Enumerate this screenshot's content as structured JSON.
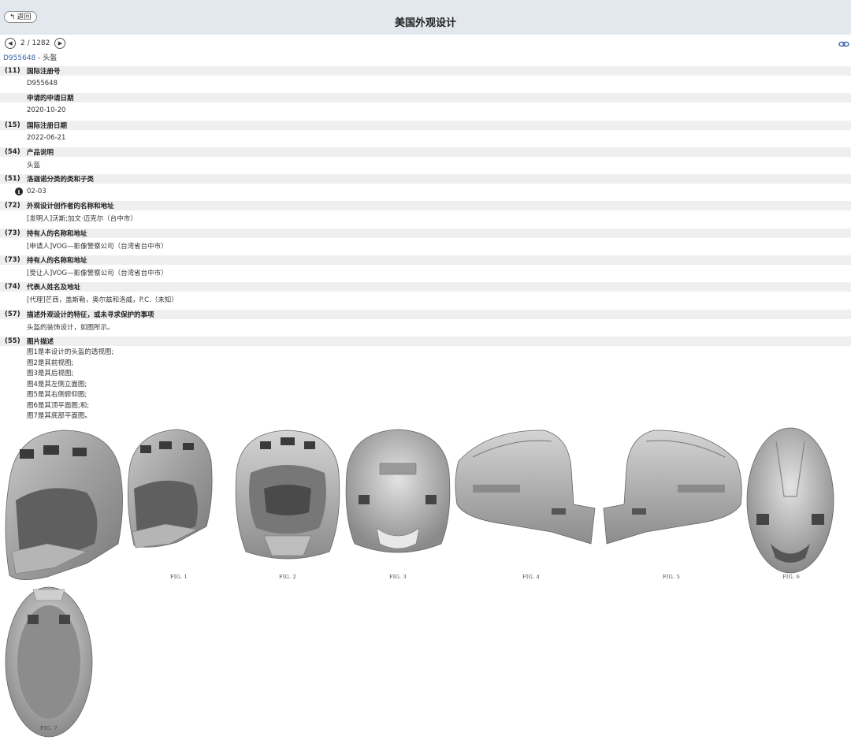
{
  "header": {
    "back_label": "返回",
    "title": "美国外观设计"
  },
  "pager": {
    "count": "2 / 1282"
  },
  "record": {
    "number": "D955648",
    "separator": " - ",
    "name": "头盔"
  },
  "fields": [
    {
      "code": "(11)",
      "label": "国际注册号",
      "value": "D955648"
    },
    {
      "code": "",
      "label": "申请的申请日期",
      "value": "2020-10-20"
    },
    {
      "code": "(15)",
      "label": "国际注册日期",
      "value": "2022-06-21"
    },
    {
      "code": "(54)",
      "label": "产品说明",
      "value": "头盔"
    },
    {
      "code": "(51)",
      "label": "洛迦诺分类的类和子类",
      "value": "02-03"
    },
    {
      "code": "(72)",
      "label": "外观设计创作者的名称和地址",
      "value": "[发明人]沃斯;加文·迈克尔（台中市）"
    },
    {
      "code": "(73)",
      "label": "持有人的名称和地址",
      "value": "[申请人]VOG—影像警察公司（台湾省台中市）"
    },
    {
      "code": "(73)",
      "label": "持有人的名称和地址",
      "value": "[受让人]VOG—影像警察公司（台湾省台中市）"
    },
    {
      "code": "(74)",
      "label": "代表人姓名及地址",
      "value": "[代理]芒西，盖斯勒，奥尔兹和洛威，P.C.（未知）"
    },
    {
      "code": "(57)",
      "label": "描述外观设计的特征，或未寻求保护的事项",
      "value": "头盔的装饰设计，如图所示。"
    }
  ],
  "description": {
    "code": "(55)",
    "label": "图片描述",
    "lines": [
      "图1是本设计的头盔的透视图;",
      "图2是其前视图;",
      "图3是其后视图;",
      "图4是其左侧立面图;",
      "图5是其右侧俯仰图;",
      "图6是其顶平面图;和;",
      "图7是其底部平面图。"
    ]
  },
  "figures": [
    {
      "label": "FIG. 1",
      "view": "perspective-large"
    },
    {
      "label": "FIG. 1",
      "view": "perspective"
    },
    {
      "label": "FIG. 2",
      "view": "front"
    },
    {
      "label": "FIG. 3",
      "view": "rear"
    },
    {
      "label": "FIG. 4",
      "view": "left-side"
    },
    {
      "label": "FIG. 5",
      "view": "right-side"
    },
    {
      "label": "FIG. 6",
      "view": "top"
    },
    {
      "label": "FIG. 7",
      "view": "bottom"
    }
  ],
  "icons": {
    "back": "back-arrow-icon",
    "prev": "chevron-left-icon",
    "next": "chevron-right-icon",
    "link": "link-icon",
    "info": "info-icon"
  },
  "colors": {
    "header_bg": "#e3e7ee",
    "field_head_bg": "#efefef",
    "link": "#3a66a8"
  }
}
